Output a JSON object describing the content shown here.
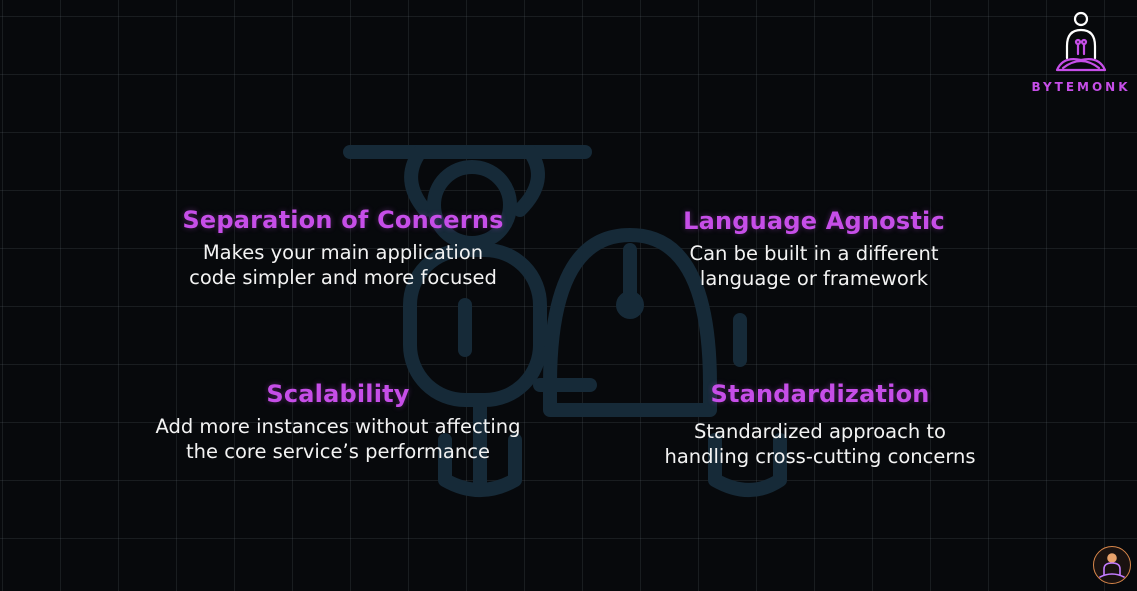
{
  "brand": {
    "name": "BYTEMONK",
    "logo_icon": "monk-meditating-icon",
    "accent_color": "#c64ee8"
  },
  "cards": [
    {
      "title": "Separation of Concerns",
      "desc": [
        "Makes your main application",
        "code simpler and more focused"
      ]
    },
    {
      "title": "Language Agnostic",
      "desc": [
        "Can be built in a different",
        "language or framework"
      ]
    },
    {
      "title": "Scalability",
      "desc": [
        "Add more instances without affecting",
        "the core service’s performance"
      ]
    },
    {
      "title": "Standardization",
      "desc": [
        "Standardized approach to",
        "handling cross-cutting concerns"
      ]
    }
  ],
  "watermark_icon": "sidecar-motorcycle-icon",
  "channel_avatar_icon": "channel-avatar-icon"
}
